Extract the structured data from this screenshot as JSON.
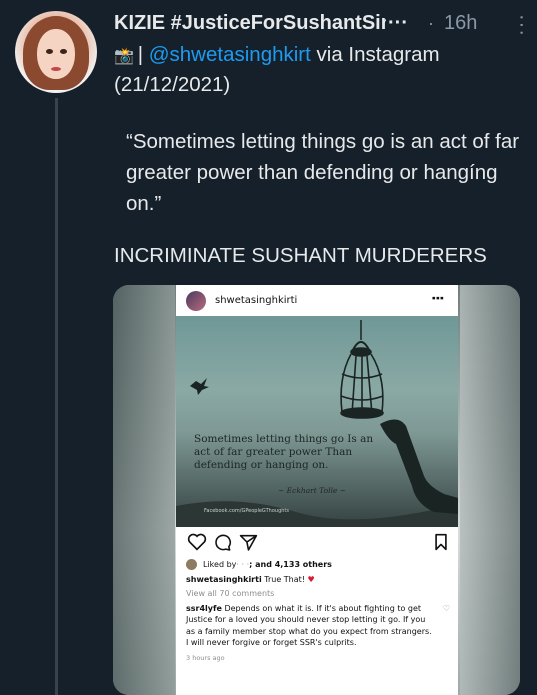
{
  "tweet": {
    "display_name": "KIZIE #JusticeForSushantSin",
    "name_truncation": "···",
    "separator": "·",
    "time": "16h",
    "more_icon": "···",
    "line1_prefix": " | ",
    "mention": "@shwetasinghkirt",
    "line1_suffix": " via Instagram",
    "line2": "(21/12/2021)",
    "quote": "“Sometimes letting things go is an act of far greater power than defending or hangíng on.”",
    "caps": "INCRIMINATE SUSHANT MURDERERS"
  },
  "instagram": {
    "username": "shwetasinghkirti",
    "more_icon": "⋮",
    "image_text": "Sometimes letting things go Is an act of far greater power Than defending or hanging on.",
    "image_author": "~ Eckhart Tolle ~",
    "image_credit": "Facebook.com/GPeopleGThoughts",
    "liked_by_prefix": "Liked by",
    "liked_by_hidden": " · · ·",
    "liked_by_suffix": "; and 4,133 others",
    "caption_user": "shwetasinghkirti",
    "caption_text": " True That! ",
    "caption_heart": "♥",
    "view_all": "View all 70 comments",
    "comment_user": "ssr4lyfe",
    "comment_text": " Depends on what it is. If it's about fighting to get Justice for a loved you should never stop letting it go. If you as a family member stop what do you expect from strangers. I will never forgive or forget SSR's culprits.",
    "comment_heart": "♡",
    "ago": "3 hours ago"
  },
  "colors": {
    "background": "#15202b",
    "text": "#e7e9ea",
    "muted": "#8b98a5",
    "accent": "#1d9bf0",
    "thread_line": "#38444d"
  },
  "icons": {
    "camera": "camera-flash-emoji",
    "heart": "heart-icon",
    "comment": "comment-icon",
    "share": "share-icon",
    "bookmark": "bookmark-icon"
  }
}
